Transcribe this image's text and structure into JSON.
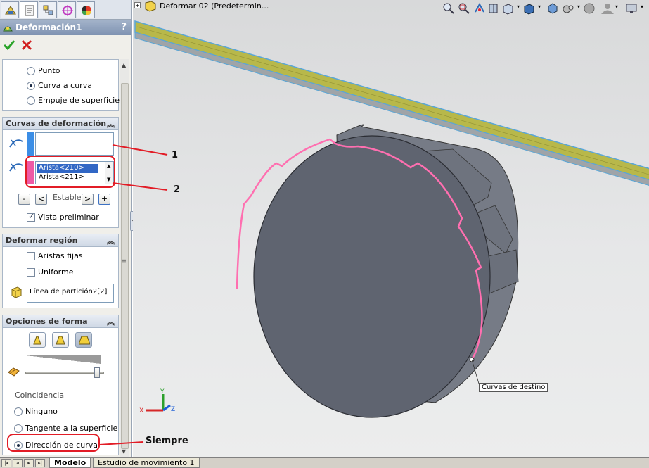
{
  "panel": {
    "tabs": [
      "feature-manager-icon",
      "property-manager-icon",
      "configuration-manager-icon",
      "dimxpert-manager-icon",
      "display-manager-icon"
    ],
    "title": "Deformación1",
    "help": "?",
    "deform_type": {
      "options": [
        "Punto",
        "Curva a curva",
        "Empuje de superficie"
      ],
      "selected": "Curva a curva"
    },
    "curves_group": {
      "title": "Curvas de deformación",
      "source_items": [],
      "target_items": [
        "Arista<210>",
        "Arista<211>"
      ],
      "stable_label": "Estable",
      "buttons": {
        "minus": "-",
        "prev": "<",
        "next": ">",
        "plus": "+"
      },
      "preview_label": "Vista preliminar",
      "preview_checked": true
    },
    "region_group": {
      "title": "Deformar región",
      "fixed_edges_label": "Aristas fijas",
      "uniform_label": "Uniforme",
      "region_value": "Línea de partición2[2]"
    },
    "shape_group": {
      "title": "Opciones de forma",
      "shape_buttons": [
        "shape-stiffness-min-icon",
        "shape-stiffness-medium-icon",
        "shape-stiffness-max-icon"
      ],
      "accuracy_level": 0.95,
      "coincidence_label": "Coincidencia",
      "coincidence_options": [
        "Ninguno",
        "Tangente a la superficie",
        "Dirección de curva"
      ],
      "coincidence_selected": "Dirección de curva"
    }
  },
  "viewport": {
    "tree_item": "Deformar 02  (Predetermin...",
    "target_curves_label": "Curvas de destino",
    "triad_axes": {
      "x": "X",
      "y": "Y",
      "z": "Z"
    }
  },
  "annotations": {
    "one": "1",
    "two": "2",
    "siempre": "Siempre"
  },
  "bottom_tabs": [
    "Modelo",
    "Estudio de movimiento 1"
  ],
  "colors": {
    "accent_red": "#e21c26",
    "target_curve_pink": "#ff6fb0",
    "part_gray": "#5f6470",
    "rail_yellow": "#b8b84a",
    "selection_blue": "#3167c5"
  }
}
